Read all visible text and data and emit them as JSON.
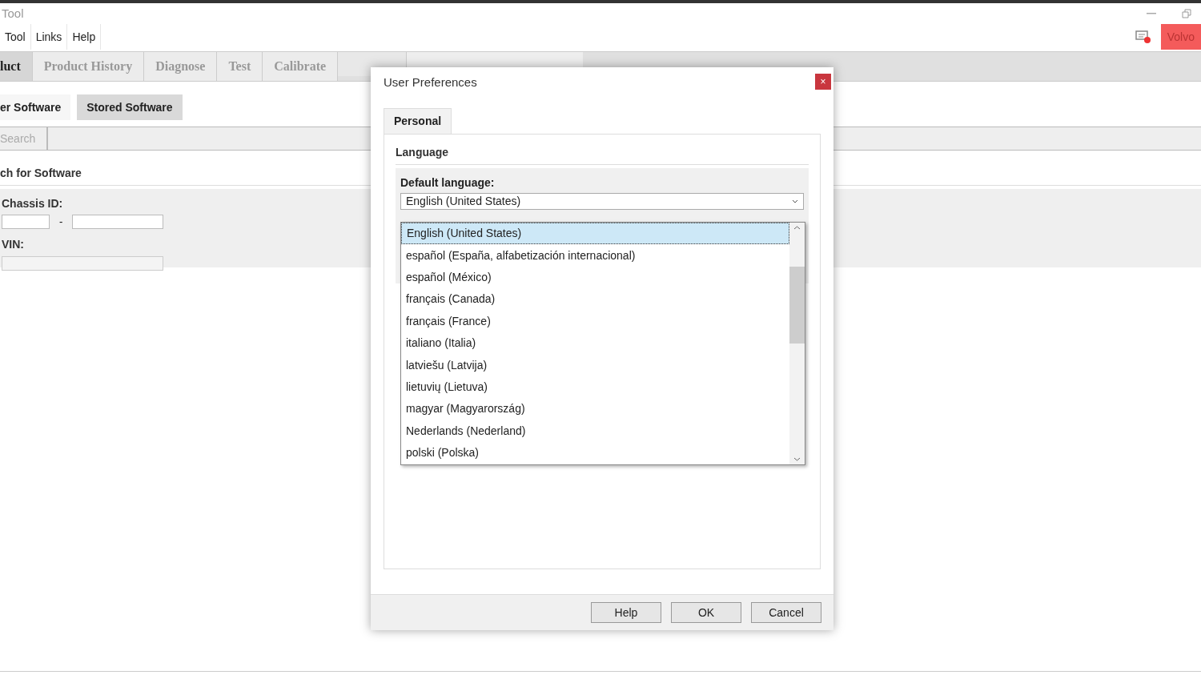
{
  "window": {
    "title": "Tool"
  },
  "menu": [
    "Tool",
    "Links",
    "Help"
  ],
  "header": {
    "brand_button": "Volvo"
  },
  "tabs": [
    {
      "label": "luct",
      "selected": true
    },
    {
      "label": "Product History",
      "selected": false
    },
    {
      "label": "Diagnose",
      "selected": false
    },
    {
      "label": "Test",
      "selected": false
    },
    {
      "label": "Calibrate",
      "selected": false
    }
  ],
  "sub_tabs": [
    {
      "label": "er Software",
      "selected": true
    },
    {
      "label": "Stored Software",
      "selected": false
    }
  ],
  "search": {
    "placeholder": "Search"
  },
  "section": {
    "title": "ch for Software",
    "chassis_label": "Chassis ID:",
    "separator": "-",
    "vin_label": "VIN:"
  },
  "dialog": {
    "title": "User Preferences",
    "close": "×",
    "tabs": [
      {
        "label": "Personal",
        "selected": true
      }
    ],
    "group": "Language",
    "field_label": "Default language:",
    "value": "English (United States)",
    "options": [
      {
        "label": "English (United States)",
        "selected": true
      },
      {
        "label": "español (España, alfabetización internacional)",
        "selected": false
      },
      {
        "label": "español (México)",
        "selected": false
      },
      {
        "label": "français (Canada)",
        "selected": false
      },
      {
        "label": "français (France)",
        "selected": false
      },
      {
        "label": "italiano (Italia)",
        "selected": false
      },
      {
        "label": "latviešu (Latvija)",
        "selected": false
      },
      {
        "label": "lietuvių (Lietuva)",
        "selected": false
      },
      {
        "label": "magyar (Magyarország)",
        "selected": false
      },
      {
        "label": "Nederlands (Nederland)",
        "selected": false
      },
      {
        "label": "polski (Polska)",
        "selected": false
      }
    ],
    "buttons": [
      "Help",
      "OK",
      "Cancel"
    ]
  }
}
